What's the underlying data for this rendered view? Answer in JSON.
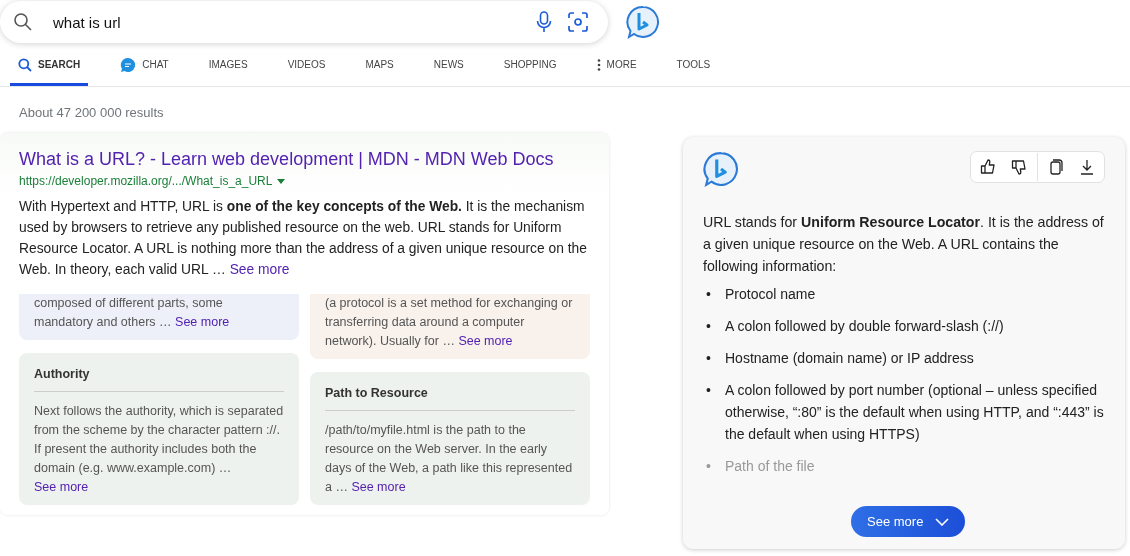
{
  "search": {
    "value": "what is url"
  },
  "tabs": [
    {
      "label": "SEARCH",
      "kind": "search",
      "selected": true
    },
    {
      "label": "CHAT",
      "kind": "chat",
      "selected": false
    },
    {
      "label": "IMAGES",
      "selected": false
    },
    {
      "label": "VIDEOS",
      "selected": false
    },
    {
      "label": "MAPS",
      "selected": false
    },
    {
      "label": "NEWS",
      "selected": false
    },
    {
      "label": "SHOPPING",
      "selected": false
    },
    {
      "label": "MORE",
      "kind": "more",
      "selected": false
    },
    {
      "label": "TOOLS",
      "selected": false
    }
  ],
  "results_count": "About 47 200 000 results",
  "result": {
    "title": "What is a URL? - Learn web development | MDN - MDN Web Docs",
    "url": "https://developer.mozilla.org/.../What_is_a_URL",
    "snippet": "With Hypertext and HTTP, URL is **one of the key concepts of the Web.** It is the mechanism used by browsers to retrieve any published resource on the web. URL stands for Uniform Resource Locator. A URL is nothing more than the address of a given unique resource on the Web. In theory, each valid URL …",
    "see_more": "See more",
    "columns": [
      [
        {
          "color": "#edf0f8",
          "text": "composed of different parts, some mandatory and others …",
          "link": "See more"
        },
        {
          "color": "#eef2ee",
          "heading": "Authority",
          "text": "Next follows the authority, which is separated from the scheme by the character pattern ://. If present the authority includes both the domain (e.g. www.example.com) …",
          "link": "See more"
        }
      ],
      [
        {
          "color": "#f8f1ec",
          "text": "(a protocol is a set method for exchanging or transferring data around a computer network). Usually for …",
          "link": "See more"
        },
        {
          "color": "#eef2ee",
          "heading": "Path to Resource",
          "text": "/path/to/myfile.html is the path to the resource on the Web server. In the early days of the Web, a path like this represented a …",
          "link": "See more"
        }
      ]
    ]
  },
  "chat": {
    "intro": "URL stands for **Uniform Resource Locator**. It is the address of a given unique resource on the Web. A URL contains the following information:",
    "bullets": [
      {
        "marker": "•",
        "text": "Protocol name",
        "faded": false
      },
      {
        "marker": "•",
        "text": "A colon followed by double forward-slash (://)",
        "faded": false
      },
      {
        "marker": "•",
        "text": "Hostname (domain name) or IP address",
        "faded": false
      },
      {
        "marker": "•",
        "text": "A colon followed by port number (optional – unless specified otherwise, “:80” is the default when using HTTP, and “:443” is the default when using HTTPS)",
        "faded": false
      },
      {
        "marker": "•",
        "text": "Path of the file",
        "faded": true
      }
    ],
    "see_more": "See more"
  }
}
